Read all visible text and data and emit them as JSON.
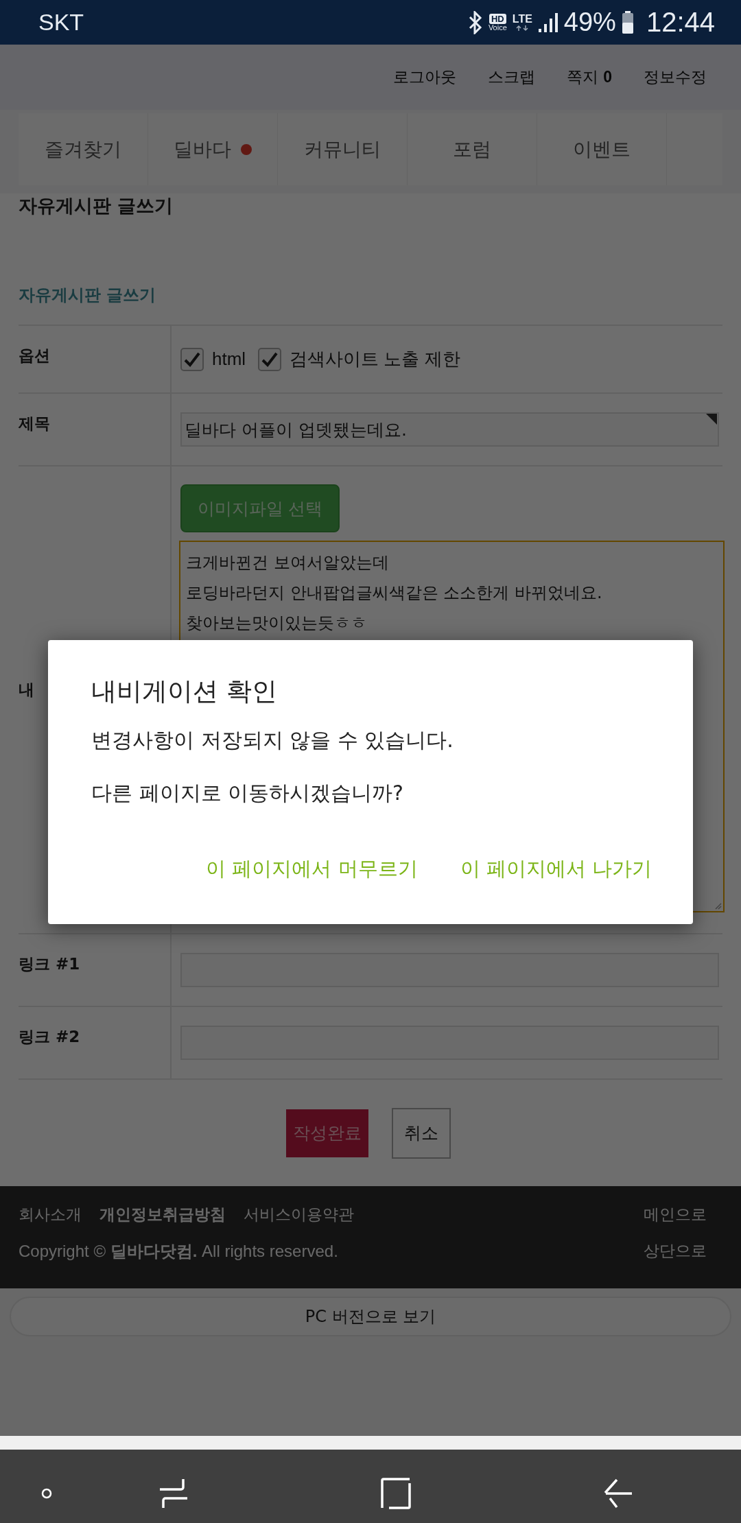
{
  "status_bar": {
    "carrier": "SKT",
    "hd_label": "HD",
    "voice_label": "Voice",
    "network": "LTE",
    "battery": "49%",
    "time": "12:44"
  },
  "top_links": [
    {
      "label": "로그아웃"
    },
    {
      "label": "스크랩"
    },
    {
      "label": "쪽지",
      "count": "0"
    },
    {
      "label": "정보수정"
    }
  ],
  "tabs": [
    {
      "label": "즐겨찾기",
      "new": false
    },
    {
      "label": "딜바다",
      "new": true
    },
    {
      "label": "커뮤니티",
      "new": false
    },
    {
      "label": "포럼",
      "new": false
    },
    {
      "label": "이벤트",
      "new": false
    }
  ],
  "page_title": "자유게시판 글쓰기",
  "form": {
    "heading": "자유게시판 글쓰기",
    "rows": [
      {
        "kind": "options",
        "label": "옵션",
        "options": [
          {
            "label": "html",
            "checked": true
          },
          {
            "label": "검색사이트 노출 제한",
            "checked": true
          }
        ]
      },
      {
        "kind": "text",
        "label": "제목",
        "value": "딜바다 어플이 업뎃됐는데요."
      },
      {
        "kind": "content",
        "label": "내",
        "upload_button": "이미지파일 선택",
        "lines": [
          "크게바뀐건 보여서알았는데",
          "로딩바라던지 안내팝업글씨색같은 소소한게 바뀌었네요.",
          "찾아보는맛이있는듯ㅎㅎ"
        ]
      },
      {
        "kind": "text",
        "label": "링크 #1"
      },
      {
        "kind": "text",
        "label": "링크 #2"
      }
    ]
  },
  "buttons": {
    "submit": "작성완료",
    "cancel": "취소"
  },
  "footer": {
    "links": [
      {
        "label": "회사소개",
        "bold": false
      },
      {
        "label": "개인정보취급방침",
        "bold": true
      },
      {
        "label": "서비스이용약관",
        "bold": false
      }
    ],
    "copyright": "Copyright © **딜바다닷컴.** All rights reserved.",
    "nav_links": [
      "메인으로",
      "상단으로"
    ]
  },
  "pc_version_button": "PC 버전으로 보기",
  "dialog": {
    "title": "내비게이션 확인",
    "messages": [
      "변경사항이 저장되지 않을 수 있습니다.",
      "다른 페이지로 이동하시겠습니까?"
    ],
    "actions": [
      "이 페이지에서 머무르기",
      "이 페이지에서 나가기"
    ]
  }
}
